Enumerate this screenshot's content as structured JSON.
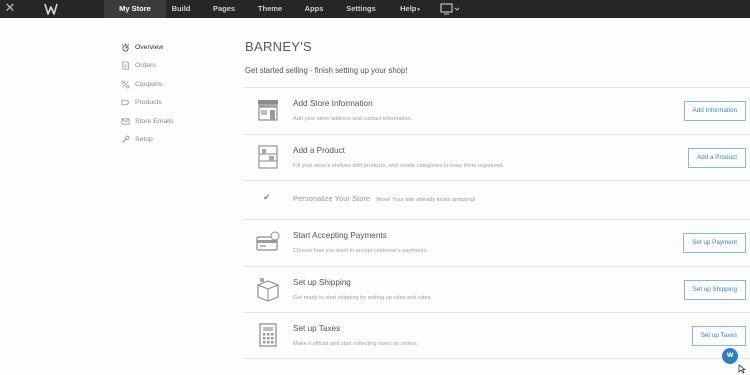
{
  "topbar": {
    "close_glyph": "✕",
    "logo_icon": "weebly-logo-icon",
    "tabs": [
      {
        "label": "My Store",
        "active": true
      },
      {
        "label": "Build",
        "active": false
      },
      {
        "label": "Pages",
        "active": false
      },
      {
        "label": "Theme",
        "active": false
      },
      {
        "label": "Apps",
        "active": false
      },
      {
        "label": "Settings",
        "active": false
      },
      {
        "label": "Help",
        "active": false,
        "has_dropdown": true
      }
    ],
    "help_caret": "▾",
    "device_icon": "device-preview-icon"
  },
  "sidebar": {
    "items": [
      {
        "label": "Overview",
        "icon": "overview-icon",
        "active": true
      },
      {
        "label": "Orders",
        "icon": "orders-icon",
        "active": false
      },
      {
        "label": "Coupons",
        "icon": "percent-icon",
        "active": false
      },
      {
        "label": "Products",
        "icon": "tag-icon",
        "active": false
      },
      {
        "label": "Store Emails",
        "icon": "email-icon",
        "active": false
      },
      {
        "label": "Setup",
        "icon": "wrench-icon",
        "active": false
      }
    ]
  },
  "main": {
    "title": "BARNEY'S",
    "subtitle": "Get started selling - finish setting up your shop!",
    "tasks": [
      {
        "title": "Add Store Information",
        "description": "Add your store address and contact information.",
        "button": "Add Information",
        "icon": "storefront-icon"
      },
      {
        "title": "Add a Product",
        "description": "Fill your store's shelves with products, and create categories to keep them organized.",
        "button": "Add a Product",
        "icon": "product-shelf-icon"
      },
      {
        "title": "Personalize Your Store",
        "description": "Wow! Your site already looks amazing!",
        "completed": true,
        "icon": "check-icon"
      },
      {
        "title": "Start Accepting Payments",
        "description": "Choose how you want to accept customer's payments.",
        "button": "Set up Payment",
        "icon": "credit-card-icon"
      },
      {
        "title": "Set up Shipping",
        "description": "Get ready to start shipping by setting up rules and rates.",
        "button": "Set up Shipping",
        "icon": "shipping-box-icon"
      },
      {
        "title": "Set up Taxes",
        "description": "Make it official and start collecting taxes on orders.",
        "button": "Set up Taxes",
        "icon": "calculator-icon"
      }
    ]
  },
  "colors": {
    "topbar": "#262626",
    "active_tab": "#3b3b3b",
    "button_text": "#3e7ec9",
    "button_border": "#8fb6e0",
    "help_badge": "#2d7fc2"
  },
  "help_badge": {
    "icon": "help-chat-icon",
    "text": "W"
  }
}
